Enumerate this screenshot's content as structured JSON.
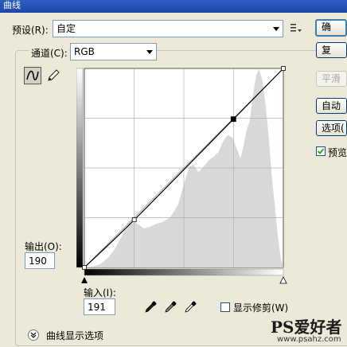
{
  "window": {
    "title": "曲线"
  },
  "preset": {
    "label": "预设(R):",
    "value": "自定"
  },
  "channel": {
    "label": "通道(C):",
    "value": "RGB"
  },
  "output": {
    "label": "输出(O):",
    "value": "190"
  },
  "input": {
    "label": "输入(I):",
    "value": "191"
  },
  "show_clipping": {
    "label": "显示修剪(W)",
    "checked": false
  },
  "curve_display_options": {
    "label": "曲线显示选项"
  },
  "buttons": {
    "ok": "确",
    "reset": "复",
    "smooth": "平滑",
    "auto": "自动",
    "options": "选项(",
    "preview": "预览"
  },
  "preview_checked": true,
  "watermark": {
    "brand": "PS爱好者",
    "url": "www.psahz.com"
  },
  "curve": {
    "points": [
      [
        0,
        0
      ],
      [
        64,
        61
      ],
      [
        191,
        190
      ],
      [
        255,
        255
      ]
    ],
    "histogram": [
      [
        0,
        0
      ],
      [
        10,
        1
      ],
      [
        20,
        4
      ],
      [
        30,
        12
      ],
      [
        38,
        22
      ],
      [
        46,
        36
      ],
      [
        52,
        48
      ],
      [
        58,
        55
      ],
      [
        64,
        58
      ],
      [
        70,
        55
      ],
      [
        76,
        50
      ],
      [
        84,
        52
      ],
      [
        92,
        56
      ],
      [
        100,
        58
      ],
      [
        110,
        64
      ],
      [
        120,
        80
      ],
      [
        128,
        108
      ],
      [
        134,
        128
      ],
      [
        140,
        132
      ],
      [
        146,
        122
      ],
      [
        152,
        128
      ],
      [
        160,
        138
      ],
      [
        166,
        142
      ],
      [
        172,
        148
      ],
      [
        178,
        162
      ],
      [
        184,
        170
      ],
      [
        190,
        166
      ],
      [
        196,
        150
      ],
      [
        200,
        140
      ],
      [
        204,
        156
      ],
      [
        208,
        176
      ],
      [
        212,
        188
      ],
      [
        216,
        220
      ],
      [
        220,
        245
      ],
      [
        224,
        255
      ],
      [
        228,
        240
      ],
      [
        232,
        210
      ],
      [
        236,
        170
      ],
      [
        240,
        120
      ],
      [
        244,
        80
      ],
      [
        248,
        40
      ],
      [
        252,
        10
      ],
      [
        255,
        0
      ]
    ]
  }
}
